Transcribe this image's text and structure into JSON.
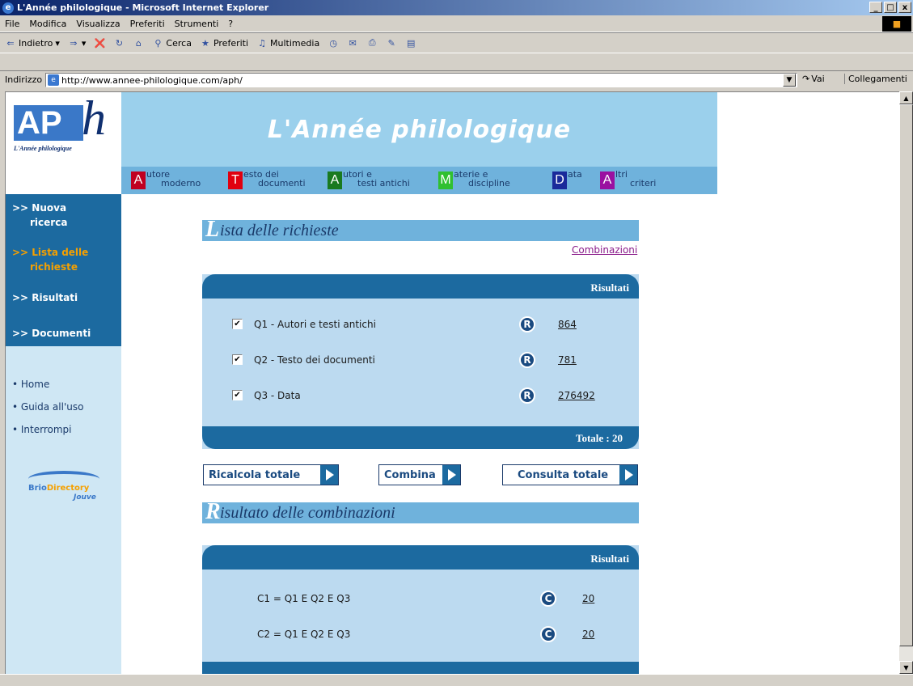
{
  "window": {
    "title": "L'Année philologique - Microsoft Internet Explorer",
    "minimize": "_",
    "maximize": "□",
    "close": "x"
  },
  "menu": {
    "items": [
      "File",
      "Modifica",
      "Visualizza",
      "Preferiti",
      "Strumenti",
      "?"
    ]
  },
  "toolbar": {
    "back": "Indietro",
    "search": "Cerca",
    "favorites": "Preferiti",
    "media": "Multimedia"
  },
  "address": {
    "label": "Indirizzo",
    "url": "http://www.annee-philologique.com/aph/",
    "go": "Vai",
    "links": "Collegamenti"
  },
  "logo": {
    "main": "AP",
    "h": "h",
    "caption": "L'Année philologique"
  },
  "banner": {
    "title": "L'Année philologique"
  },
  "nav": [
    {
      "letter": "A",
      "line1": "utore",
      "line2": "moderno",
      "color": "#c00020"
    },
    {
      "letter": "T",
      "line1": "esto dei",
      "line2": "documenti",
      "color": "#e00010"
    },
    {
      "letter": "A",
      "line1": "utori e",
      "line2": "testi antichi",
      "color": "#1a7a20"
    },
    {
      "letter": "M",
      "line1": "aterie e",
      "line2": "discipline",
      "color": "#30c030"
    },
    {
      "letter": "D",
      "line1": "ata",
      "line2": "",
      "color": "#1a2a9a"
    },
    {
      "letter": "A",
      "line1": "ltri",
      "line2": "criteri",
      "color": "#9a10a0"
    }
  ],
  "sidebar": {
    "items": [
      ">> Nuova",
      "ricerca",
      ">> Lista delle",
      "richieste",
      ">> Risultati",
      ">> Documenti"
    ],
    "links": [
      "• Home",
      "• Guida all'uso",
      "• Interrompi"
    ],
    "brio": {
      "brio": "Brio",
      "directory": "Directory",
      "jouve": "Jouve"
    }
  },
  "requests": {
    "title_initial": "L",
    "title_rest": "ista delle richieste",
    "combine_link": "Combinazioni",
    "header": "Risultati",
    "rows": [
      {
        "check": "✔",
        "label": "Q1 - Autori e testi antichi",
        "icon": "R",
        "value": "864"
      },
      {
        "check": "✔",
        "label": "Q2 - Testo dei documenti",
        "icon": "R",
        "value": "781"
      },
      {
        "check": "✔",
        "label": "Q3 - Data",
        "icon": "R",
        "value": "276492"
      }
    ],
    "total": "Totale : 20"
  },
  "actions": {
    "recalc": "Ricalcola totale",
    "combine": "Combina",
    "view_total": "Consulta totale"
  },
  "combinations": {
    "title_initial": "R",
    "title_rest": "isultato delle combinazioni",
    "header": "Risultati",
    "rows": [
      {
        "label": "C1 = Q1 E Q2 E Q3",
        "icon": "C",
        "value": "20"
      },
      {
        "label": "C2 = Q1 E Q2 E Q3",
        "icon": "C",
        "value": "20"
      }
    ]
  }
}
